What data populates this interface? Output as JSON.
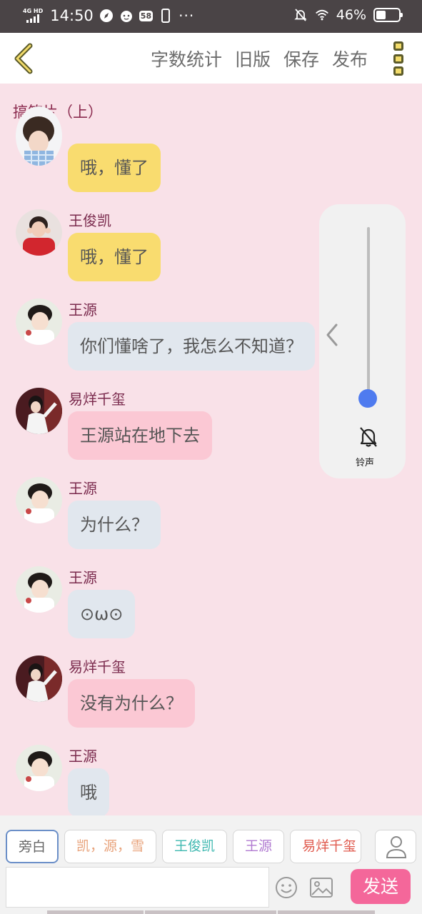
{
  "status_bar": {
    "network": "4G HD",
    "time": "14:50",
    "notification_badge": "58",
    "battery": "46%"
  },
  "header": {
    "actions": [
      "字数统计",
      "旧版",
      "保存",
      "发布"
    ]
  },
  "chat": {
    "title": "搞笑片（上）",
    "messages": [
      {
        "name": "",
        "text": "哦，懂了",
        "style": "yellow",
        "avatar": "girl-avatar"
      },
      {
        "name": "王俊凯",
        "text": "哦，懂了",
        "style": "yellow",
        "avatar": "wangjunkai-avatar"
      },
      {
        "name": "王源",
        "text": "你们懂啥了，我怎么不知道？",
        "style": "blue",
        "avatar": "wangyuan-avatar"
      },
      {
        "name": "易烊千玺",
        "text": "王源站在地下去",
        "style": "pink",
        "avatar": "yiyangqianxi-avatar"
      },
      {
        "name": "王源",
        "text": "为什么？",
        "style": "blue",
        "avatar": "wangyuan-avatar"
      },
      {
        "name": "王源",
        "text": "⊙ω⊙",
        "style": "blue",
        "avatar": "wangyuan-avatar"
      },
      {
        "name": "易烊千玺",
        "text": "没有为什么？",
        "style": "pink",
        "avatar": "yiyangqianxi-avatar"
      },
      {
        "name": "王源",
        "text": "哦",
        "style": "blue",
        "avatar": "wangyuan-avatar"
      }
    ]
  },
  "volume_panel": {
    "label": "铃声",
    "level": 0.05
  },
  "roles": [
    {
      "label": "旁白",
      "color": "#666666",
      "selected": true
    },
    {
      "label": "凯，源，雪",
      "color": "#e8a27a",
      "selected": false
    },
    {
      "label": "王俊凯",
      "color": "#3fb8b0",
      "selected": false
    },
    {
      "label": "王源",
      "color": "#b17bd1",
      "selected": false
    },
    {
      "label": "易烊千玺",
      "color": "#e05a4e",
      "selected": false
    }
  ],
  "composer": {
    "input_value": "",
    "send_label": "发送"
  },
  "colors": {
    "background": "#f9e1e8",
    "send_button": "#f4679a",
    "bubble_yellow": "#f9dc6f",
    "bubble_blue": "#e1e7ee",
    "bubble_pink": "#fbc8d4"
  }
}
